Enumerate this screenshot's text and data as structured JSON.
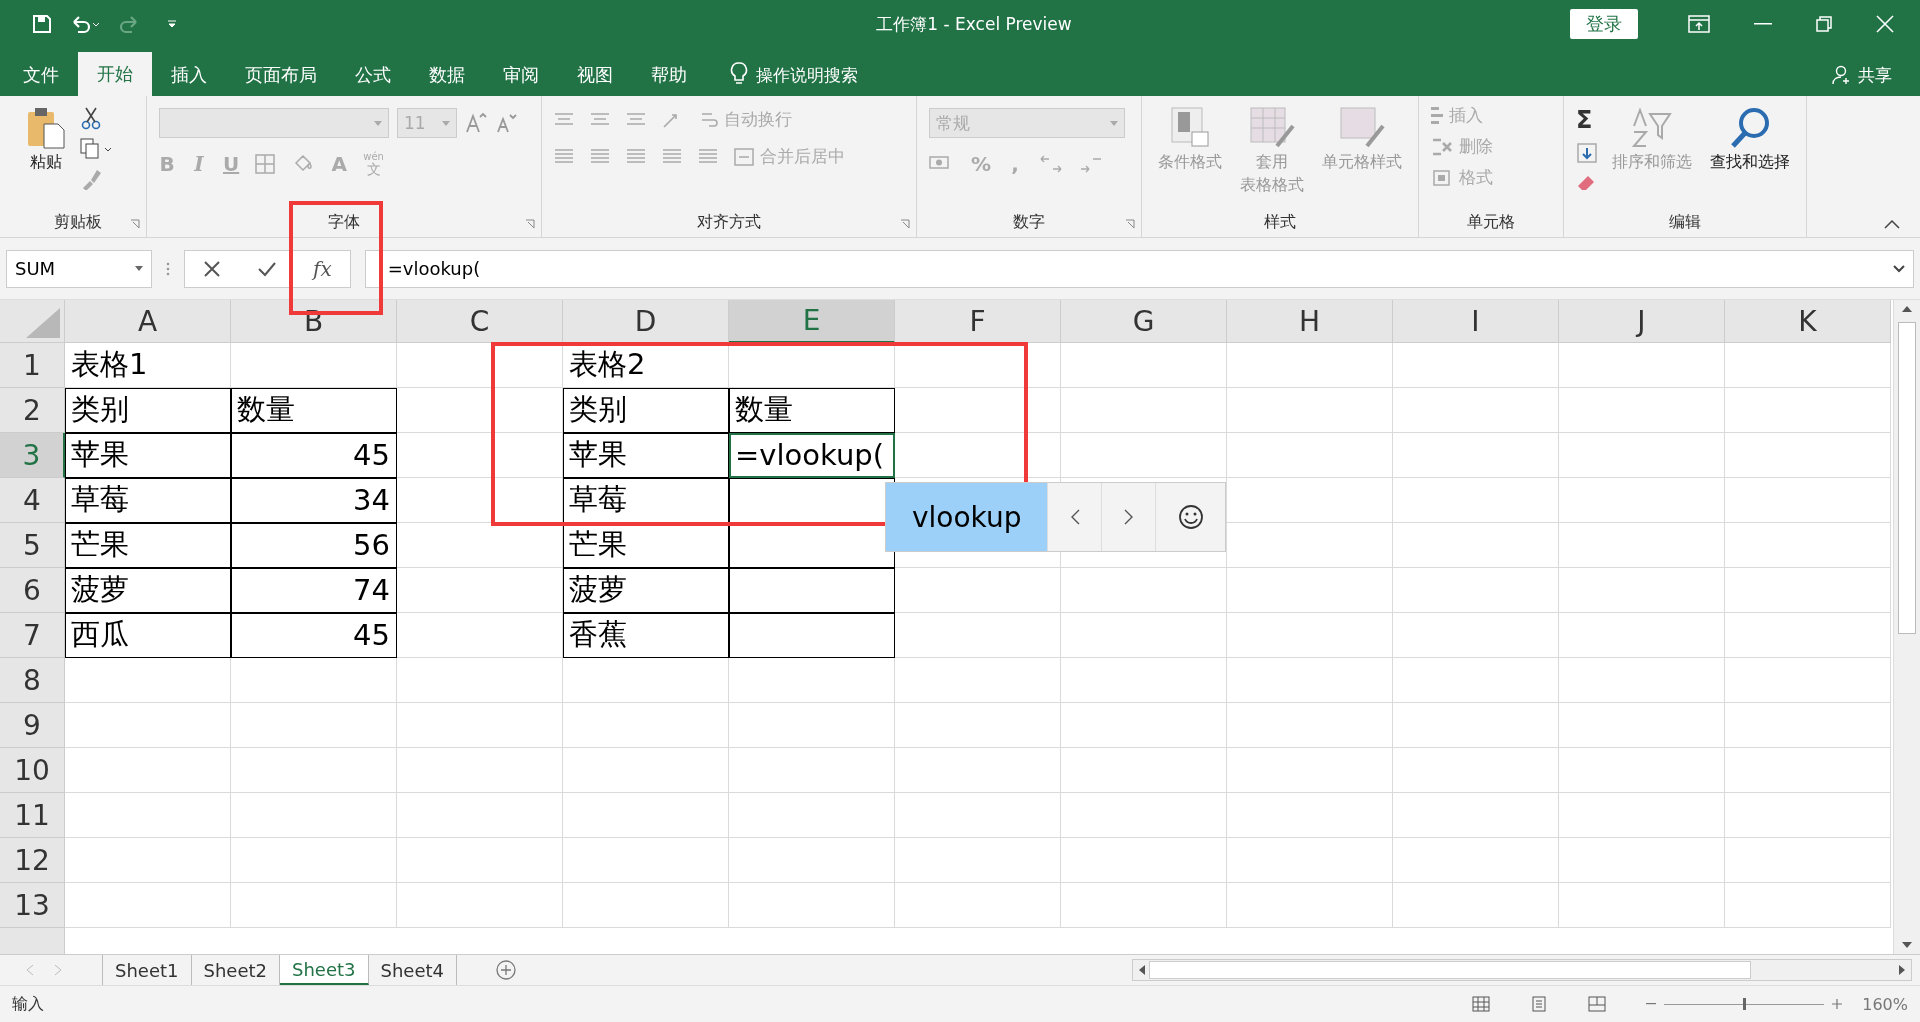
{
  "title_bar": {
    "title": "工作簿1 - Excel Preview",
    "login": "登录"
  },
  "ribbon_tabs": [
    {
      "label": "文件",
      "selected": false
    },
    {
      "label": "开始",
      "selected": true
    },
    {
      "label": "插入",
      "selected": false
    },
    {
      "label": "页面布局",
      "selected": false
    },
    {
      "label": "公式",
      "selected": false
    },
    {
      "label": "数据",
      "selected": false
    },
    {
      "label": "审阅",
      "selected": false
    },
    {
      "label": "视图",
      "selected": false
    },
    {
      "label": "帮助",
      "selected": false
    }
  ],
  "tell_me": "操作说明搜索",
  "share": "共享",
  "clipboard": {
    "paste": "粘贴",
    "label": "剪贴板"
  },
  "font": {
    "size": "11",
    "bold": "B",
    "italic": "I",
    "underline": "U",
    "font_color": "A",
    "phonetic_top": "wén",
    "phonetic_bottom": "文",
    "label": "字体"
  },
  "alignment": {
    "wrap": "自动换行",
    "merge": "合并后居中",
    "label": "对齐方式"
  },
  "number": {
    "format": "常规",
    "percent": "%",
    "comma": ",",
    "label": "数字"
  },
  "styles": {
    "conditional": "条件格式",
    "table_top": "套用",
    "table_bottom": "表格格式",
    "cell_styles": "单元格样式",
    "label": "样式"
  },
  "cells": {
    "insert": "插入",
    "delete": "删除",
    "format": "格式",
    "label": "单元格"
  },
  "editing": {
    "sum": "Σ",
    "sort": "排序和筛选",
    "find": "查找和选择",
    "label": "编辑"
  },
  "formula_bar": {
    "name_box": "SUM",
    "fx": "fx",
    "formula": "=vlookup("
  },
  "columns": [
    {
      "label": "A",
      "selected": false
    },
    {
      "label": "B",
      "selected": false
    },
    {
      "label": "C",
      "selected": false
    },
    {
      "label": "D",
      "selected": false
    },
    {
      "label": "E",
      "selected": true
    },
    {
      "label": "F",
      "selected": false
    },
    {
      "label": "G",
      "selected": false
    },
    {
      "label": "H",
      "selected": false
    },
    {
      "label": "I",
      "selected": false
    },
    {
      "label": "J",
      "selected": false
    },
    {
      "label": "K",
      "selected": false
    }
  ],
  "rows": [
    {
      "header": "1",
      "selected": false,
      "cells": [
        {
          "text": "表格1",
          "bordered": false
        },
        {
          "bordered": false
        },
        {
          "bordered": false
        },
        {
          "text": "表格2",
          "bordered": false
        },
        {
          "bordered": false
        },
        {
          "bordered": false
        },
        {
          "bordered": false
        },
        {
          "bordered": false
        },
        {
          "bordered": false
        },
        {
          "bordered": false
        },
        {
          "bordered": false
        }
      ]
    },
    {
      "header": "2",
      "selected": false,
      "cells": [
        {
          "text": "类别",
          "bordered": true
        },
        {
          "text": "数量",
          "bordered": true
        },
        {
          "bordered": false
        },
        {
          "text": "类别",
          "bordered": true
        },
        {
          "text": "数量",
          "bordered": true
        },
        {
          "bordered": false
        },
        {
          "bordered": false
        },
        {
          "bordered": false
        },
        {
          "bordered": false
        },
        {
          "bordered": false
        },
        {
          "bordered": false
        }
      ]
    },
    {
      "header": "3",
      "selected": true,
      "cells": [
        {
          "text": "苹果",
          "bordered": true
        },
        {
          "text": "45",
          "kind": "number",
          "bordered": true
        },
        {
          "bordered": false
        },
        {
          "text": "苹果",
          "bordered": true
        },
        {
          "text": "=vlookup(",
          "bordered": true,
          "editing": true
        },
        {
          "bordered": false
        },
        {
          "bordered": false
        },
        {
          "bordered": false
        },
        {
          "bordered": false
        },
        {
          "bordered": false
        },
        {
          "bordered": false
        }
      ]
    },
    {
      "header": "4",
      "selected": false,
      "cells": [
        {
          "text": "草莓",
          "bordered": true
        },
        {
          "text": "34",
          "kind": "number",
          "bordered": true
        },
        {
          "bordered": false
        },
        {
          "text": "草莓",
          "bordered": true
        },
        {
          "bordered": true
        },
        {
          "bordered": false
        },
        {
          "bordered": false
        },
        {
          "bordered": false
        },
        {
          "bordered": false
        },
        {
          "bordered": false
        },
        {
          "bordered": false
        }
      ]
    },
    {
      "header": "5",
      "selected": false,
      "cells": [
        {
          "text": "芒果",
          "bordered": true
        },
        {
          "text": "56",
          "kind": "number",
          "bordered": true
        },
        {
          "bordered": false
        },
        {
          "text": "芒果",
          "bordered": true
        },
        {
          "bordered": true
        },
        {
          "bordered": false
        },
        {
          "bordered": false
        },
        {
          "bordered": false
        },
        {
          "bordered": false
        },
        {
          "bordered": false
        },
        {
          "bordered": false
        }
      ]
    },
    {
      "header": "6",
      "selected": false,
      "cells": [
        {
          "text": "菠萝",
          "bordered": true
        },
        {
          "text": "74",
          "kind": "number",
          "bordered": true
        },
        {
          "bordered": false
        },
        {
          "text": "菠萝",
          "bordered": true
        },
        {
          "bordered": true
        },
        {
          "bordered": false
        },
        {
          "bordered": false
        },
        {
          "bordered": false
        },
        {
          "bordered": false
        },
        {
          "bordered": false
        },
        {
          "bordered": false
        }
      ]
    },
    {
      "header": "7",
      "selected": false,
      "cells": [
        {
          "text": "西瓜",
          "bordered": true
        },
        {
          "text": "45",
          "kind": "number",
          "bordered": true
        },
        {
          "bordered": false
        },
        {
          "text": "香蕉",
          "bordered": true
        },
        {
          "bordered": true
        },
        {
          "bordered": false
        },
        {
          "bordered": false
        },
        {
          "bordered": false
        },
        {
          "bordered": false
        },
        {
          "bordered": false
        },
        {
          "bordered": false
        }
      ]
    },
    {
      "header": "8",
      "selected": false,
      "cells": [
        {
          "bordered": false
        },
        {
          "bordered": false
        },
        {
          "bordered": false
        },
        {
          "bordered": false
        },
        {
          "bordered": false
        },
        {
          "bordered": false
        },
        {
          "bordered": false
        },
        {
          "bordered": false
        },
        {
          "bordered": false
        },
        {
          "bordered": false
        },
        {
          "bordered": false
        }
      ]
    },
    {
      "header": "9",
      "selected": false,
      "cells": [
        {
          "bordered": false
        },
        {
          "bordered": false
        },
        {
          "bordered": false
        },
        {
          "bordered": false
        },
        {
          "bordered": false
        },
        {
          "bordered": false
        },
        {
          "bordered": false
        },
        {
          "bordered": false
        },
        {
          "bordered": false
        },
        {
          "bordered": false
        },
        {
          "bordered": false
        }
      ]
    },
    {
      "header": "10",
      "selected": false,
      "cells": [
        {
          "bordered": false
        },
        {
          "bordered": false
        },
        {
          "bordered": false
        },
        {
          "bordered": false
        },
        {
          "bordered": false
        },
        {
          "bordered": false
        },
        {
          "bordered": false
        },
        {
          "bordered": false
        },
        {
          "bordered": false
        },
        {
          "bordered": false
        },
        {
          "bordered": false
        }
      ]
    },
    {
      "header": "11",
      "selected": false,
      "cells": [
        {
          "bordered": false
        },
        {
          "bordered": false
        },
        {
          "bordered": false
        },
        {
          "bordered": false
        },
        {
          "bordered": false
        },
        {
          "bordered": false
        },
        {
          "bordered": false
        },
        {
          "bordered": false
        },
        {
          "bordered": false
        },
        {
          "bordered": false
        },
        {
          "bordered": false
        }
      ]
    },
    {
      "header": "12",
      "selected": false,
      "cells": [
        {
          "bordered": false
        },
        {
          "bordered": false
        },
        {
          "bordered": false
        },
        {
          "bordered": false
        },
        {
          "bordered": false
        },
        {
          "bordered": false
        },
        {
          "bordered": false
        },
        {
          "bordered": false
        },
        {
          "bordered": false
        },
        {
          "bordered": false
        },
        {
          "bordered": false
        }
      ]
    },
    {
      "header": "13",
      "selected": false,
      "cells": [
        {
          "bordered": false
        },
        {
          "bordered": false
        },
        {
          "bordered": false
        },
        {
          "bordered": false
        },
        {
          "bordered": false
        },
        {
          "bordered": false
        },
        {
          "bordered": false
        },
        {
          "bordered": false
        },
        {
          "bordered": false
        },
        {
          "bordered": false
        },
        {
          "bordered": false
        }
      ]
    }
  ],
  "autocomplete": {
    "suggestion": "vlookup"
  },
  "sheet_tabs": [
    {
      "label": "Sheet1",
      "selected": false
    },
    {
      "label": "Sheet2",
      "selected": false
    },
    {
      "label": "Sheet3",
      "selected": true
    },
    {
      "label": "Sheet4",
      "selected": false
    }
  ],
  "status_bar": {
    "mode": "输入",
    "zoom_slider": {
      "level": 0.5
    },
    "zoom": "160%"
  }
}
